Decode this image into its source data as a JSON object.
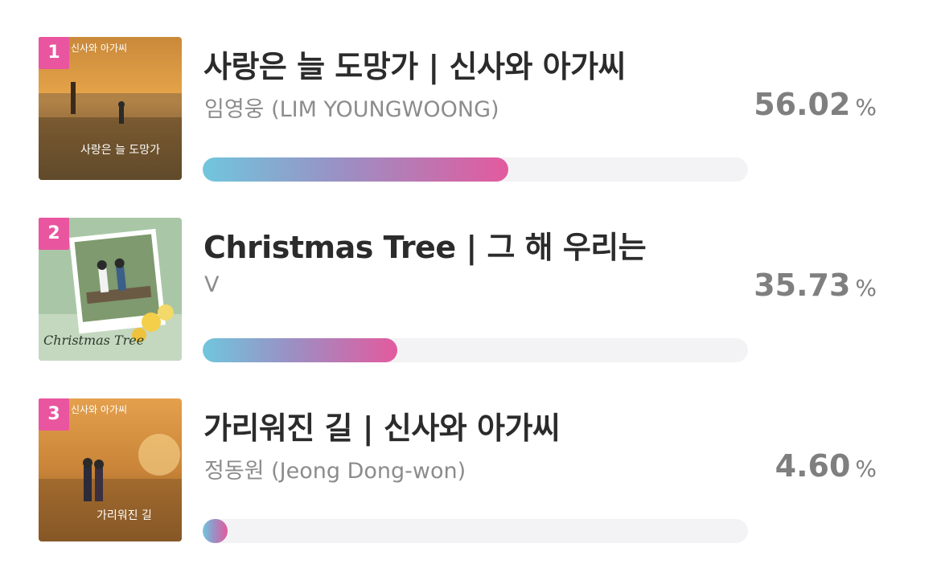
{
  "ranking": [
    {
      "rank": "1",
      "title": "사랑은 늘 도망가 | 신사와 아가씨",
      "artist": "임영웅 (LIM YOUNGWOONG)",
      "percent": "56.02",
      "percent_value": 56.02,
      "unit": "%",
      "cover_icon": "album-art-sunset-lighthouse"
    },
    {
      "rank": "2",
      "title": "Christmas Tree | 그 해 우리는",
      "artist": "V",
      "percent": "35.73",
      "percent_value": 35.73,
      "unit": "%",
      "cover_icon": "album-art-couple-bench-flowers"
    },
    {
      "rank": "3",
      "title": "가리워진 길 | 신사와 아가씨",
      "artist": "정동원 (Jeong Dong-won)",
      "percent": "4.60",
      "percent_value": 4.6,
      "unit": "%",
      "cover_icon": "album-art-couple-field"
    }
  ],
  "colors": {
    "rank_badge": "#e9559f",
    "bar_start": "#70c6dd",
    "bar_end": "#e35a9e",
    "track": "#f3f3f5"
  }
}
